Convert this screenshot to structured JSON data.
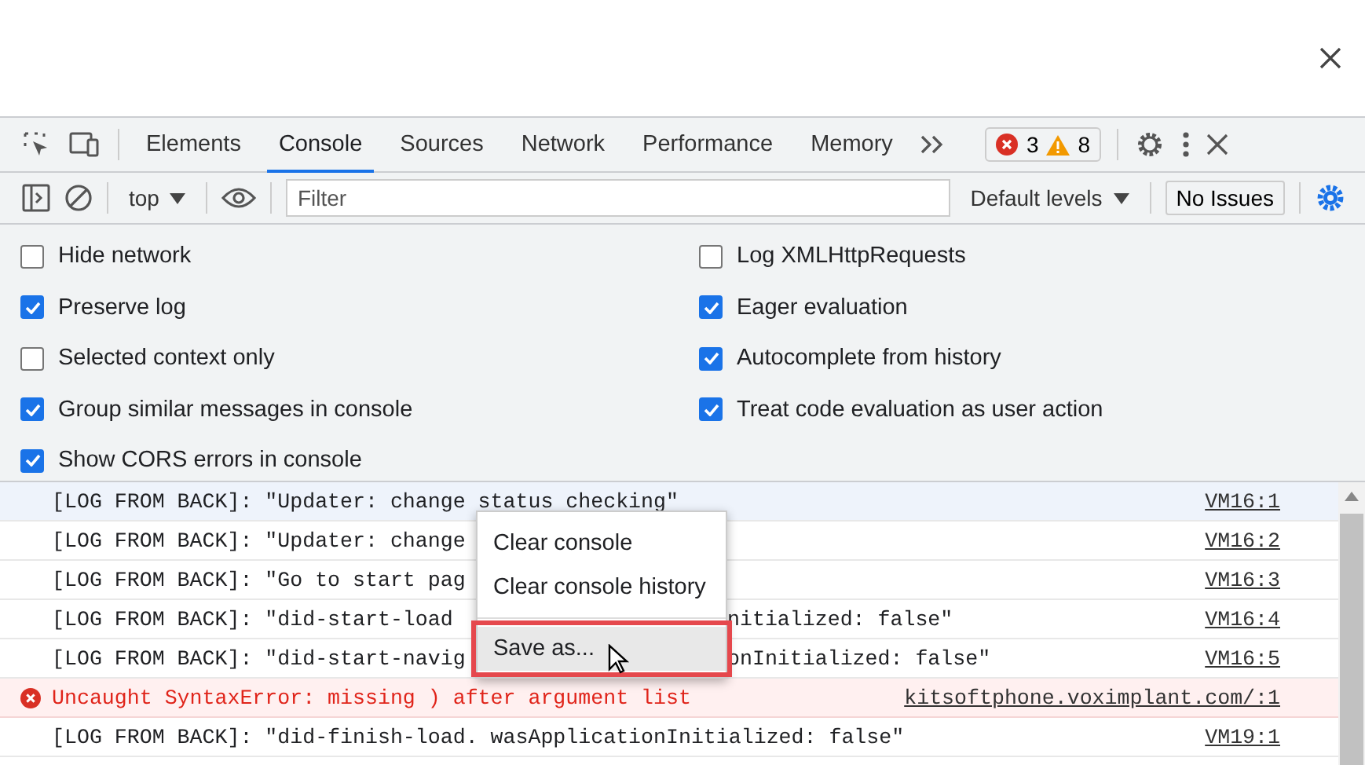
{
  "tabs": [
    {
      "label": "Elements",
      "selected": false
    },
    {
      "label": "Console",
      "selected": true
    },
    {
      "label": "Sources",
      "selected": false
    },
    {
      "label": "Network",
      "selected": false
    },
    {
      "label": "Performance",
      "selected": false
    },
    {
      "label": "Memory",
      "selected": false
    }
  ],
  "counts": {
    "errors": "3",
    "warnings": "8"
  },
  "toolbar": {
    "context": "top",
    "filter_placeholder": "Filter",
    "levels": "Default levels",
    "issues": "No Issues"
  },
  "settings": [
    [
      {
        "label": "Hide network",
        "checked": false
      },
      {
        "label": "Preserve log",
        "checked": true
      },
      {
        "label": "Selected context only",
        "checked": false
      },
      {
        "label": "Group similar messages in console",
        "checked": true
      },
      {
        "label": "Show CORS errors in console",
        "checked": true
      }
    ],
    [
      {
        "label": "Log XMLHttpRequests",
        "checked": false
      },
      {
        "label": "Eager evaluation",
        "checked": true
      },
      {
        "label": "Autocomplete from history",
        "checked": true
      },
      {
        "label": "Treat code evaluation as user action",
        "checked": true
      }
    ]
  ],
  "messages": [
    {
      "kind": "log",
      "highlighted": true,
      "text": "[LOG FROM BACK]: \"Updater: change status checking\"",
      "source": "VM16:1"
    },
    {
      "kind": "log",
      "highlighted": false,
      "text": "[LOG FROM BACK]: \"Updater: change",
      "source": "VM16:2"
    },
    {
      "kind": "log",
      "highlighted": false,
      "text": "[LOG FROM BACK]: \"Go to start pag",
      "source": "VM16:3"
    },
    {
      "kind": "log",
      "highlighted": false,
      "text": "[LOG FROM BACK]: \"did-start-load",
      "text_after": "nitialized: false\"",
      "source": "VM16:4"
    },
    {
      "kind": "log",
      "highlighted": false,
      "text": "[LOG FROM BACK]: \"did-start-navig",
      "text_after": "onInitialized: false\"",
      "source": "VM16:5"
    },
    {
      "kind": "error",
      "highlighted": false,
      "text": "Uncaught SyntaxError: missing ) after argument list",
      "source": "kitsoftphone.voximplant.com/:1"
    },
    {
      "kind": "log",
      "highlighted": false,
      "text": "[LOG FROM BACK]: \"did-finish-load. wasApplicationInitialized: false\"",
      "source": "VM19:1"
    }
  ],
  "context_menu": {
    "items": [
      {
        "kind": "item",
        "label": "Clear console",
        "hovered": false,
        "outlined": false
      },
      {
        "kind": "item",
        "label": "Clear console history",
        "hovered": false,
        "outlined": false
      },
      {
        "kind": "separator"
      },
      {
        "kind": "item",
        "label": "Save as...",
        "hovered": true,
        "outlined": true
      }
    ]
  }
}
